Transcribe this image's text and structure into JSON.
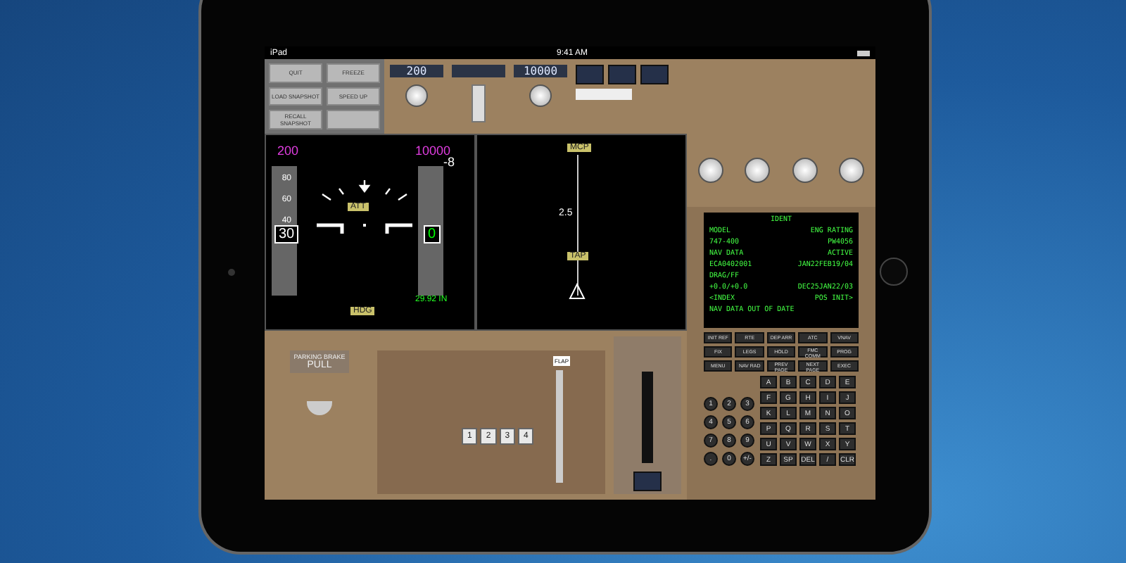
{
  "status_bar": {
    "device": "iPad",
    "time": "9:41 AM"
  },
  "sim_buttons": [
    {
      "label": "QUIT"
    },
    {
      "label": "FREEZE"
    },
    {
      "label": "LOAD SNAPSHOT"
    },
    {
      "label": "SPEED UP"
    },
    {
      "label": "RECALL SNAPSHOT"
    }
  ],
  "mcp": {
    "speed": "200",
    "altitude": "10000"
  },
  "pfd": {
    "selected_speed": "200",
    "selected_altitude": "10000",
    "vertical_speed": "-8",
    "speed": "30",
    "altitude": "0",
    "baro": "29.92 IN",
    "speed_ticks": [
      "80",
      "60",
      "40"
    ],
    "mode": "ATT",
    "bottom_mode": "HDG"
  },
  "nd": {
    "top_mode": "MCP",
    "scale": "2.5",
    "mid_mode": "TAP"
  },
  "fmc": {
    "title": "IDENT",
    "lines": [
      {
        "left": "MODEL",
        "right": "ENG RATING"
      },
      {
        "left": "747-400",
        "right": "PW4056"
      },
      {
        "left": "NAV DATA",
        "right": "ACTIVE"
      },
      {
        "left": "ECA0402001",
        "right": "JAN22FEB19/04"
      },
      {
        "left": "DRAG/FF"
      },
      {
        "left": "+0.0/+0.0",
        "right": "DEC25JAN22/03"
      },
      {
        "left": "<INDEX",
        "right": "POS INIT>"
      }
    ],
    "message": "NAV DATA OUT OF DATE",
    "function_keys": [
      "INIT REF",
      "RTE",
      "DEP ARR",
      "ATC",
      "VNAV",
      "FIX",
      "LEGS",
      "HOLD",
      "FMC COMM",
      "PROG",
      "MENU",
      "NAV RAD",
      "PREV PAGE",
      "NEXT PAGE"
    ],
    "exec_key": "EXEC",
    "number_keys": [
      "1",
      "2",
      "3",
      "4",
      "5",
      "6",
      "7",
      "8",
      "9",
      ".",
      "0",
      "+/-"
    ],
    "letter_keys": [
      "A",
      "B",
      "C",
      "D",
      "E",
      "F",
      "G",
      "H",
      "I",
      "J",
      "K",
      "L",
      "M",
      "N",
      "O",
      "P",
      "Q",
      "R",
      "S",
      "T",
      "U",
      "V",
      "W",
      "X",
      "Y",
      "Z",
      "SP",
      "DEL",
      "/",
      "CLR"
    ]
  },
  "throttle": {
    "levers": [
      "1",
      "2",
      "3",
      "4"
    ],
    "flap_label": "FLAP",
    "brake_title": "PARKING BRAKE",
    "brake_action": "PULL"
  }
}
